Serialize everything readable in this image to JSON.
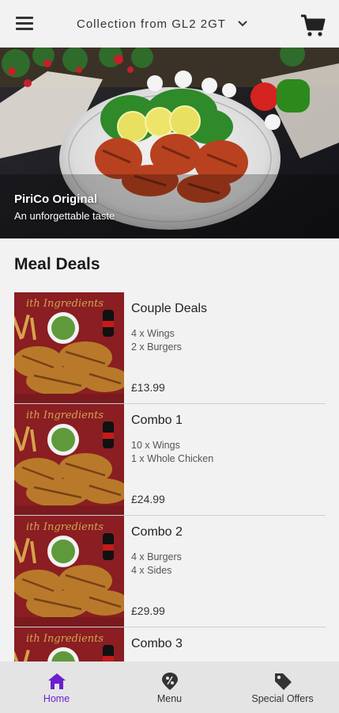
{
  "header": {
    "collection_label": "Collection from GL2 2GT"
  },
  "hero": {
    "title": "PiriCo Original",
    "subtitle": "An unforgettable taste"
  },
  "section_title": "Meal Deals",
  "deals": [
    {
      "name": "Couple Deals",
      "lines": [
        "4 x Wings",
        "2 x Burgers"
      ],
      "price": "£13.99"
    },
    {
      "name": "Combo 1",
      "lines": [
        "10 x Wings",
        "1 x Whole Chicken"
      ],
      "price": "£24.99"
    },
    {
      "name": "Combo 2",
      "lines": [
        "4 x Burgers",
        "4 x Sides"
      ],
      "price": "£29.99"
    },
    {
      "name": "Combo 3",
      "lines": [
        "",
        ""
      ],
      "price": ""
    }
  ],
  "nav": [
    {
      "label": "Home",
      "icon": "home-icon",
      "active": true
    },
    {
      "label": "Menu",
      "icon": "menu-tag-icon",
      "active": false
    },
    {
      "label": "Special Offers",
      "icon": "special-offers-tag-icon",
      "active": false
    }
  ],
  "colors": {
    "accent": "#6a1fd1",
    "background": "#f2f2f2",
    "nav_background": "#e4e4e4"
  }
}
